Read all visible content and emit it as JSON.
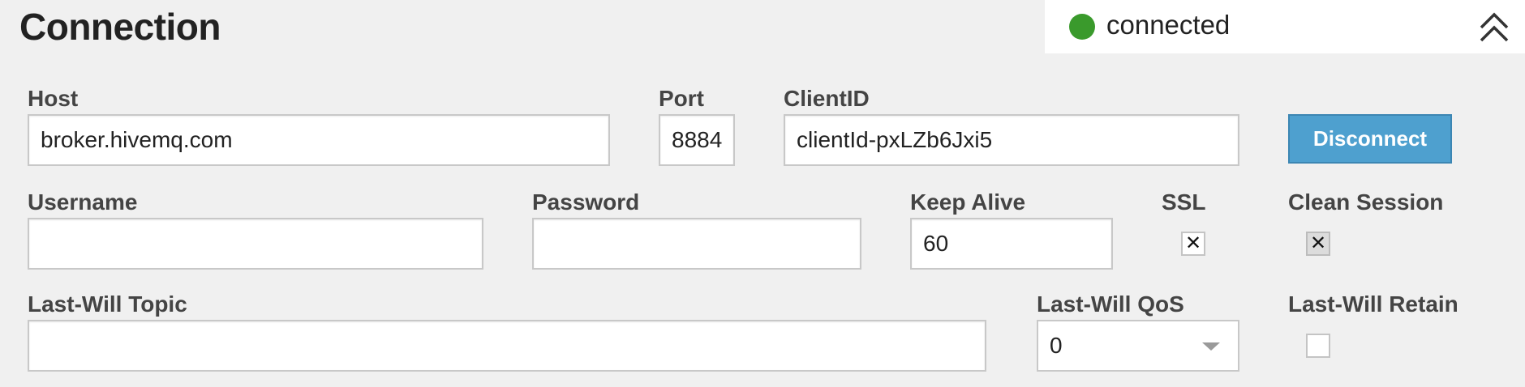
{
  "panel": {
    "title": "Connection",
    "status": {
      "text": "connected",
      "color": "#3a9a2c"
    },
    "collapse_icon": "chevron-double-up-icon"
  },
  "fields": {
    "host": {
      "label": "Host",
      "value": "broker.hivemq.com"
    },
    "port": {
      "label": "Port",
      "value": "8884"
    },
    "client_id": {
      "label": "ClientID",
      "value": "clientId-pxLZb6Jxi5"
    },
    "username": {
      "label": "Username",
      "value": ""
    },
    "password": {
      "label": "Password",
      "value": ""
    },
    "keep_alive": {
      "label": "Keep Alive",
      "value": "60"
    },
    "ssl": {
      "label": "SSL",
      "checked": true,
      "mark": "✕"
    },
    "clean_session": {
      "label": "Clean Session",
      "checked": true,
      "mark": "✕",
      "disabled": true
    },
    "lastwill_topic": {
      "label": "Last-Will Topic",
      "value": ""
    },
    "lastwill_qos": {
      "label": "Last-Will QoS",
      "value": "0"
    },
    "lastwill_retain": {
      "label": "Last-Will Retain",
      "checked": false,
      "mark": ""
    }
  },
  "actions": {
    "disconnect_label": "Disconnect",
    "accent_color": "#4ea0cf"
  }
}
